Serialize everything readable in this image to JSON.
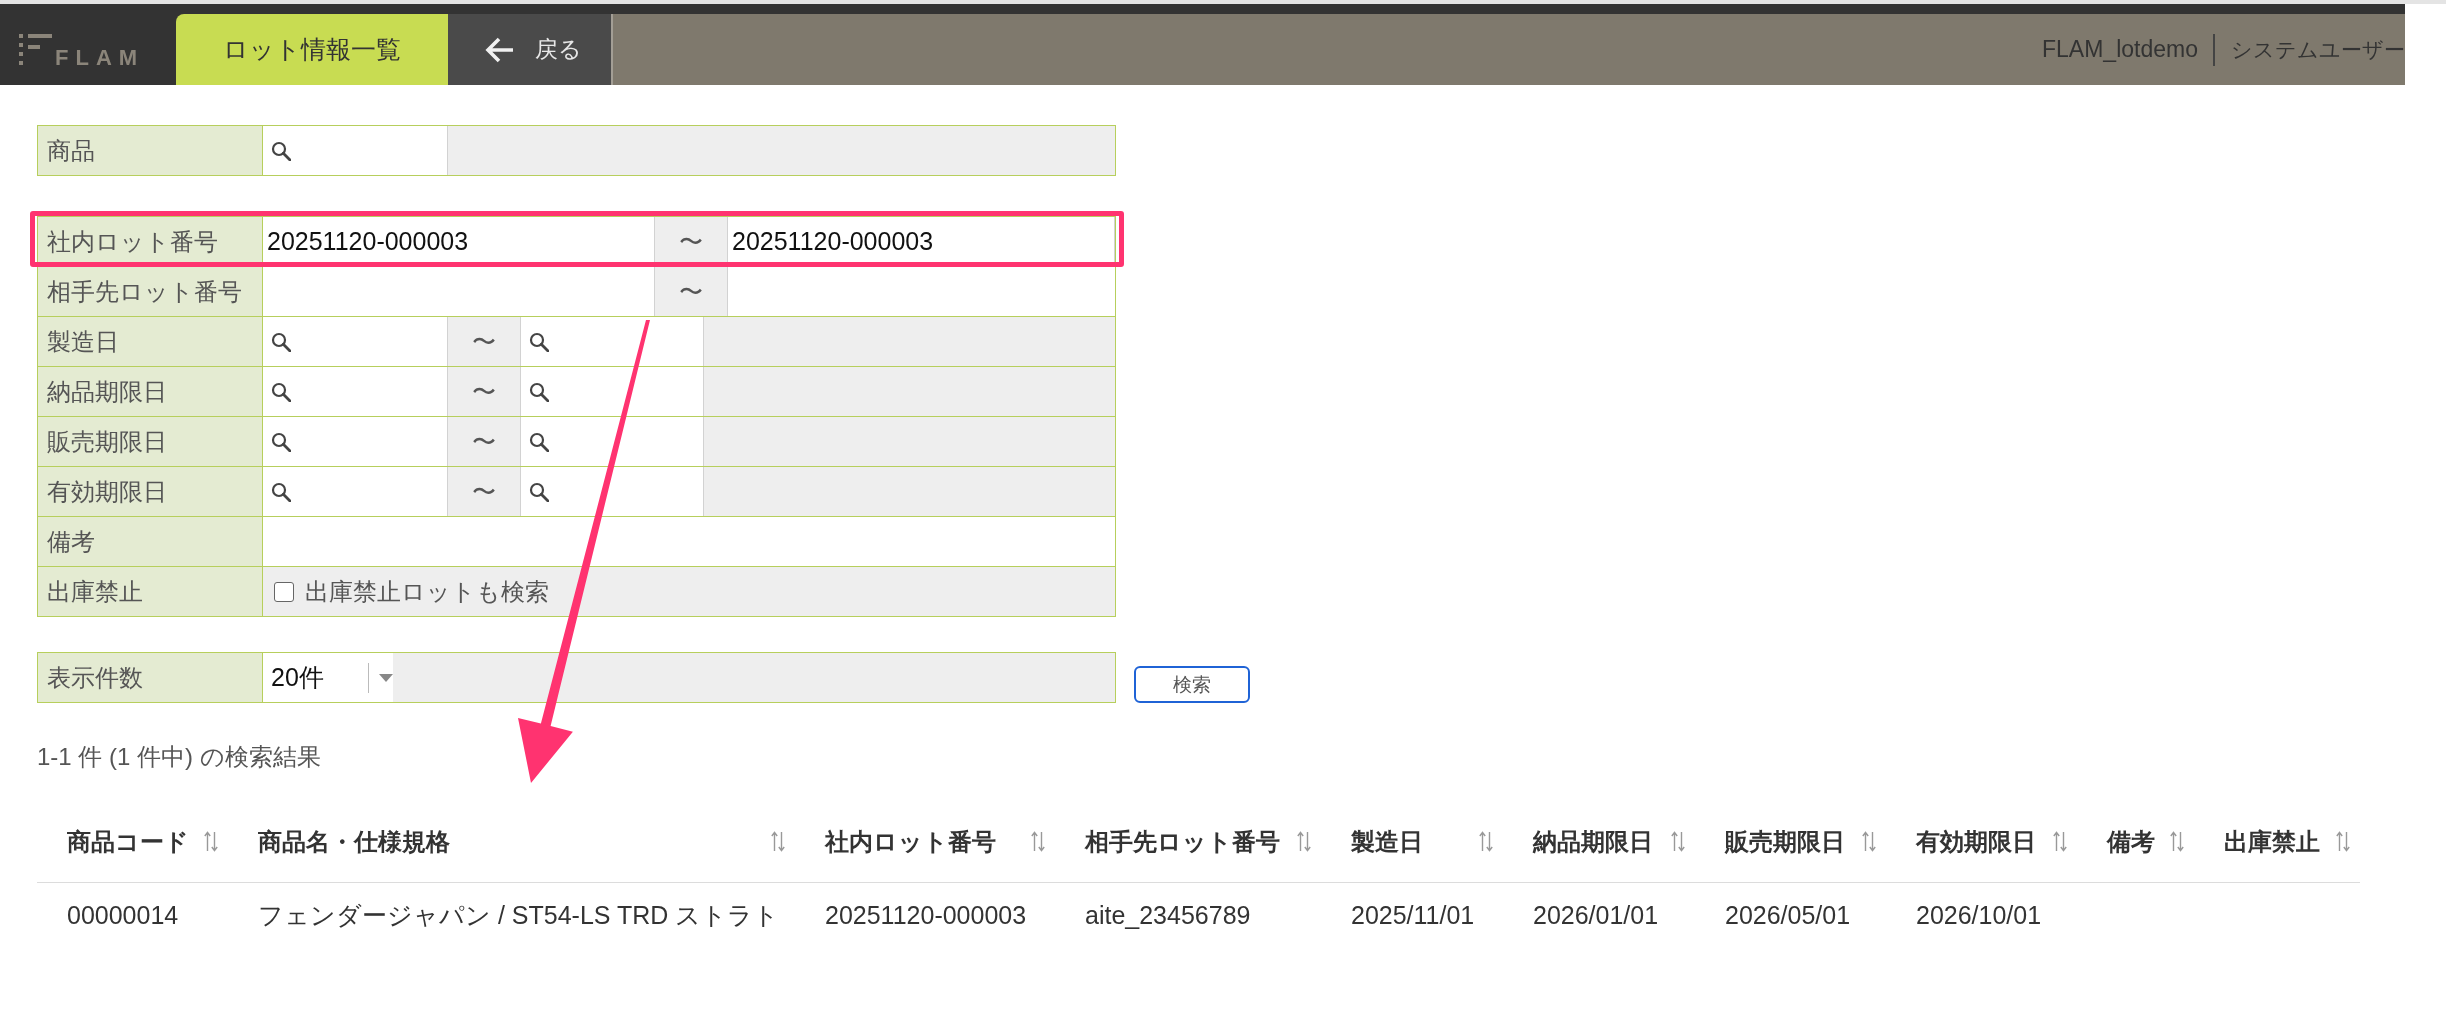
{
  "header": {
    "logo_text": "FLAM",
    "tabs": [
      {
        "label": "ロット情報一覧",
        "selected": true
      }
    ],
    "back_button": "戻る",
    "account": "FLAM_lotdemo",
    "user": "システムユーザー"
  },
  "product_filter": {
    "kind": "lookup",
    "label": "商品",
    "highlighted": false
  },
  "filters": [
    {
      "kind": "text_range",
      "label": "社内ロット番号",
      "from": "20251120-000003",
      "separator": "〜",
      "to": "20251120-000003",
      "highlighted": true
    },
    {
      "kind": "text_range",
      "label": "相手先ロット番号",
      "separator": "〜",
      "highlighted": false
    },
    {
      "kind": "date_range",
      "label": "製造日",
      "separator": "〜",
      "highlighted": false
    },
    {
      "kind": "date_range",
      "label": "納品期限日",
      "separator": "〜",
      "highlighted": false
    },
    {
      "kind": "date_range",
      "label": "販売期限日",
      "separator": "〜",
      "highlighted": false
    },
    {
      "kind": "date_range",
      "label": "有効期限日",
      "separator": "〜",
      "highlighted": false
    },
    {
      "kind": "text",
      "label": "備考",
      "highlighted": false
    },
    {
      "kind": "checkbox",
      "label": "出庫禁止",
      "option": "出庫禁止ロットも検索",
      "checked": false,
      "highlighted": false
    }
  ],
  "display_count": {
    "label": "表示件数",
    "value": "20件"
  },
  "search_button": "検索",
  "result_summary": "1-1 件 (1 件中) の検索結果",
  "results_table": {
    "columns": [
      "商品コード",
      "商品名・仕様規格",
      "社内ロット番号",
      "相手先ロット番号",
      "製造日",
      "納品期限日",
      "販売期限日",
      "有効期限日",
      "備考",
      "出庫禁止"
    ],
    "rows": [
      {
        "cells": [
          "00000014",
          "フェンダージャパン / ST54-LS TRD ストラト",
          "20251120-000003",
          "aite_23456789",
          "2025/11/01",
          "2026/01/01",
          "2026/05/01",
          "2026/10/01"
        ]
      }
    ]
  }
}
